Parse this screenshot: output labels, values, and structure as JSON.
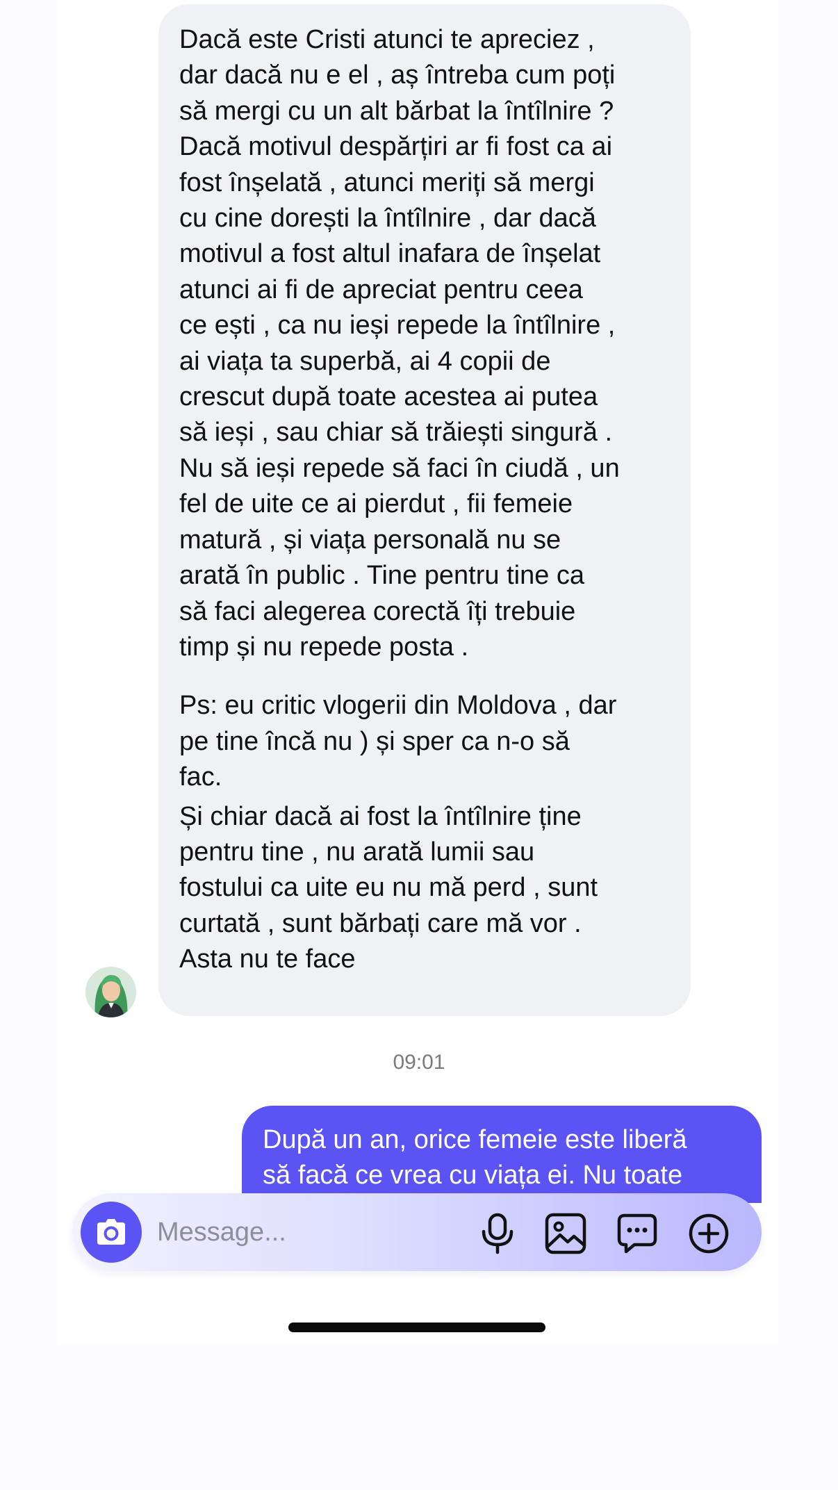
{
  "incoming_message": {
    "paragraph_1": "Dacă este Cristi atunci te apreciez ,\ndar dacă nu e el , aș întreba cum poți\nsă mergi cu un alt bărbat la întîlnire ?\nDacă motivul despărțiri ar fi fost ca ai\nfost înșelată , atunci meriți să mergi\ncu cine dorești la întîlnire , dar dacă\nmotivul a fost altul inafara de înșelat\natunci ai fi de apreciat pentru ceea\nce ești , ca nu ieși repede la întîlnire ,\nai viața ta superbă, ai 4 copii de\ncrescut după toate acestea ai putea\nsă ieși , sau chiar să trăiești singură .\nNu să ieși repede să faci în ciudă , un\nfel de uite ce ai pierdut , fii femeie\nmatură , și viața personală nu se\narată în public . Tine pentru tine ca\nsă faci alegerea corectă îți trebuie\ntimp și nu repede posta .",
    "paragraph_2": "Ps: eu critic vlogerii din Moldova , dar\npe tine încă nu ) și sper ca n-o să\nfac.",
    "paragraph_3": "Și chiar dacă ai fost la întîlnire ține\npentru tine , nu arată lumii sau\nfostului ca uite eu nu mă perd , sunt\ncurtată , sunt bărbați care mă vor .\nAsta nu te face"
  },
  "timestamp": "09:01",
  "outgoing_message": {
    "text": "După un an, orice femeie este liberă\nsă facă ce vrea cu viața ei. Nu toate"
  },
  "composer": {
    "placeholder": "Message...",
    "icons": [
      "camera-icon",
      "microphone-icon",
      "image-icon",
      "chat-bubble-icon",
      "plus-circle-icon"
    ]
  },
  "colors": {
    "accent": "#5b53f4",
    "incoming_bubble": "#eff1f5",
    "timestamp": "#7a7a80"
  }
}
